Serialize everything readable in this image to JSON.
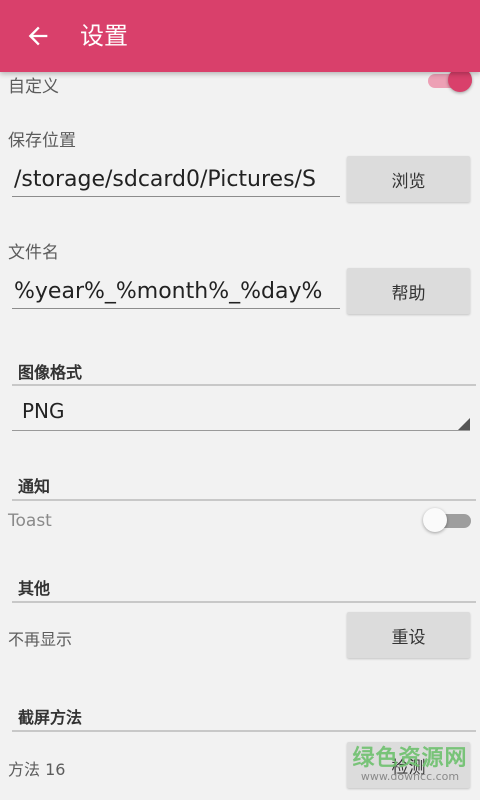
{
  "appbar": {
    "title": "设置",
    "back_icon": "arrow-left-icon"
  },
  "custom": {
    "label": "自定义",
    "switch_on": true
  },
  "save_location": {
    "label": "保存位置",
    "value": "/storage/sdcard0/Pictures/S",
    "button": "浏览"
  },
  "file_name": {
    "label": "文件名",
    "value": "%year%_%month%_%day%",
    "button": "帮助"
  },
  "image_format": {
    "section_title": "图像格式",
    "selected": "PNG"
  },
  "notification": {
    "section_title": "通知",
    "toast_label": "Toast",
    "toast_on": false
  },
  "other": {
    "section_title": "其他",
    "no_show_label": "不再显示",
    "reset_button": "重设"
  },
  "screenshot_method": {
    "section_title": "截屏方法",
    "method_label": "方法 16",
    "detect_button": "检测"
  },
  "watermark": {
    "main": "绿色资源网",
    "url": "www.downcc.com"
  },
  "colors": {
    "accent": "#d9406b",
    "background": "#f2f2f2",
    "button": "#dcdcdc"
  }
}
